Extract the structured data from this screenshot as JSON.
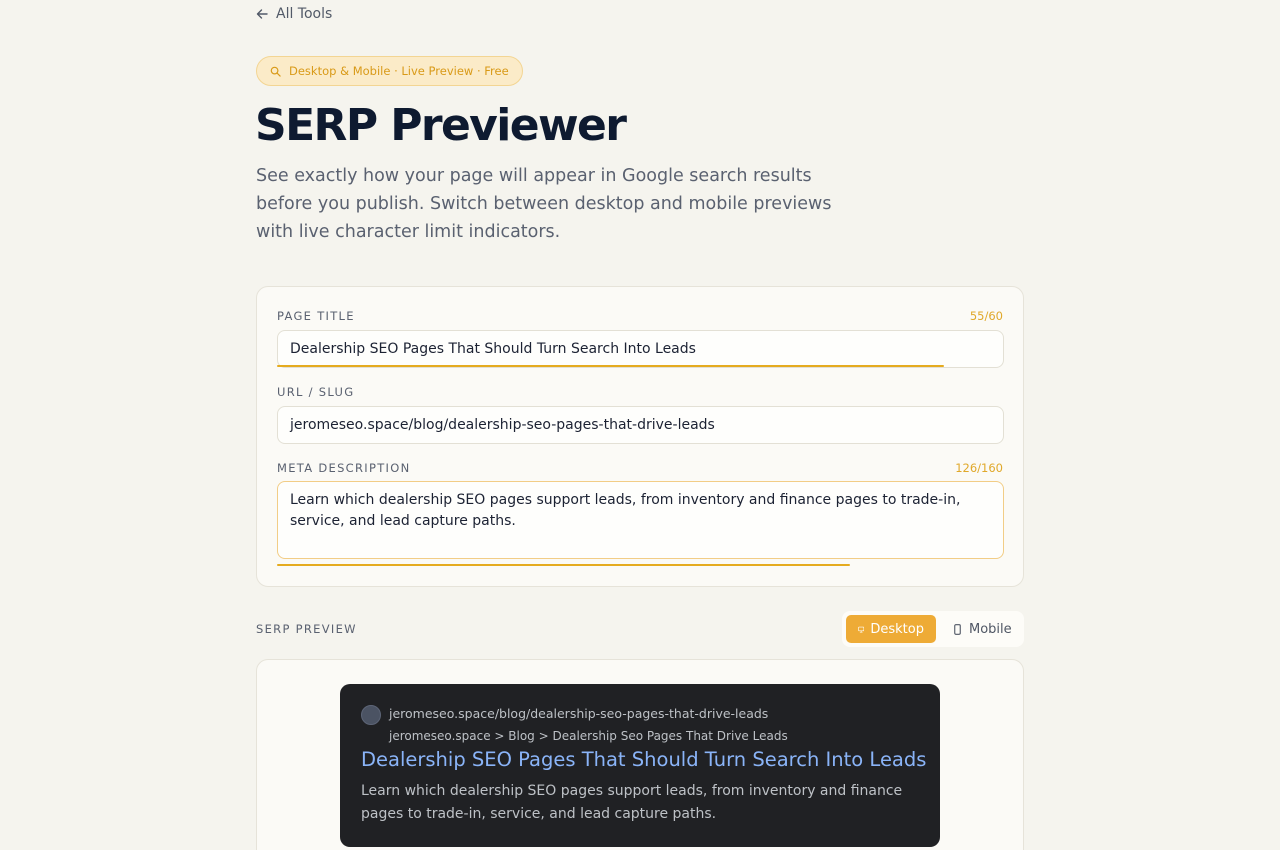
{
  "nav": {
    "back_label": "All Tools"
  },
  "badge": {
    "label": "Desktop & Mobile · Live Preview · Free"
  },
  "header": {
    "title": "SERP Previewer",
    "description": "See exactly how your page will appear in Google search results before you publish. Switch between desktop and mobile previews with live character limit indicators."
  },
  "form": {
    "title_label": "PAGE TITLE",
    "title_count": "55/60",
    "title_value": "Dealership SEO Pages That Should Turn Search Into Leads",
    "title_progress": 0.917,
    "url_label": "URL / SLUG",
    "url_value": "jeromeseo.space/blog/dealership-seo-pages-that-drive-leads",
    "desc_label": "META DESCRIPTION",
    "desc_count": "126/160",
    "desc_value": "Learn which dealership SEO pages support leads, from inventory and finance pages to trade-in, service, and lead capture paths.",
    "desc_progress": 0.7875
  },
  "preview": {
    "section_label": "SERP PREVIEW",
    "toggle": {
      "desktop_label": "Desktop",
      "mobile_label": "Mobile",
      "selected": "Desktop"
    },
    "result": {
      "url": "jeromeseo.space/blog/dealership-seo-pages-that-drive-leads",
      "breadcrumb": "jeromeseo.space > Blog > Dealership Seo Pages That Drive Leads",
      "title": "Dealership SEO Pages That Should Turn Search Into Leads",
      "description": "Learn which dealership SEO pages support leads, from inventory and finance pages to trade-in, service, and lead capture paths."
    }
  },
  "colors": {
    "accent": "#eeab36",
    "serp_bg": "#202124",
    "serp_link": "#8ab4f8"
  },
  "icons": {
    "back": "arrow-left-icon",
    "badge": "search-icon",
    "desktop": "monitor-icon",
    "mobile": "phone-icon"
  }
}
